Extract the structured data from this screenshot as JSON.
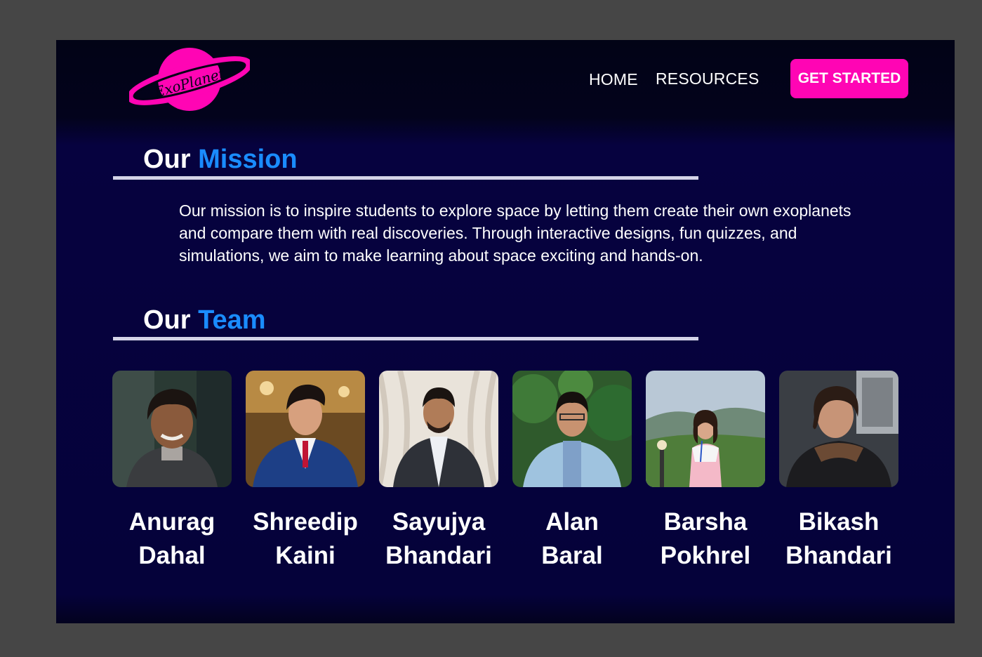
{
  "header": {
    "logo_text": "ExoPlanet",
    "nav": {
      "home": "HOME",
      "resources": "RESOURCES"
    },
    "cta_label": "GET STARTED"
  },
  "mission": {
    "title_prefix": "Our",
    "title_accent": "Mission",
    "text": "Our mission is to inspire students to explore space by letting them create their own exoplanets and compare them with real discoveries. Through interactive designs, fun quizzes, and simulations, we aim to make learning about space exciting and hands-on."
  },
  "team": {
    "title_prefix": "Our",
    "title_accent": "Team",
    "members": [
      {
        "first": "Anurag",
        "last": "Dahal"
      },
      {
        "first": "Shreedip",
        "last": "Kaini"
      },
      {
        "first": "Sayujya",
        "last": "Bhandari"
      },
      {
        "first": "Alan",
        "last": "Baral"
      },
      {
        "first": "Barsha",
        "last": "Pokhrel"
      },
      {
        "first": "Bikash",
        "last": "Bhandari"
      }
    ]
  },
  "colors": {
    "accent_pink": "#ff05b4",
    "accent_blue": "#1a8cff",
    "background": "#05023a"
  }
}
